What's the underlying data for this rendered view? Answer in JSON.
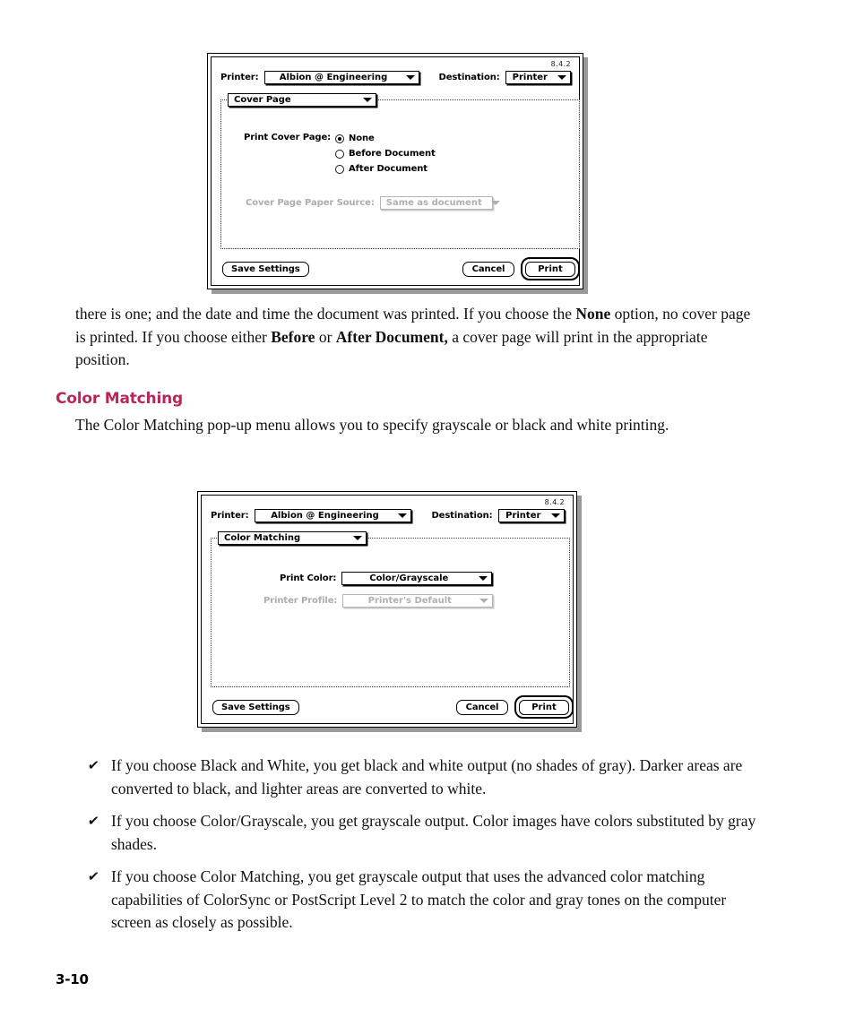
{
  "page": {
    "number": "3-10"
  },
  "dialog_cover_page": {
    "version": "8.4.2",
    "printer_label": "Printer:",
    "printer_value": "Albion @ Engineering",
    "destination_label": "Destination:",
    "destination_value": "Printer",
    "pane_popup_value": "Cover Page",
    "print_cover_page_label": "Print Cover Page:",
    "options": [
      {
        "label": "None",
        "selected": true
      },
      {
        "label": "Before Document",
        "selected": false
      },
      {
        "label": "After Document",
        "selected": false
      }
    ],
    "paper_source_label": "Cover Page Paper Source:",
    "paper_source_value": "Same as document",
    "save_settings_label": "Save Settings",
    "cancel_label": "Cancel",
    "print_label": "Print"
  },
  "dialog_color_matching": {
    "version": "8.4.2",
    "printer_label": "Printer:",
    "printer_value": "Albion @ Engineering",
    "destination_label": "Destination:",
    "destination_value": "Printer",
    "pane_popup_value": "Color Matching",
    "print_color_label": "Print Color:",
    "print_color_value": "Color/Grayscale",
    "printer_profile_label": "Printer Profile:",
    "printer_profile_value": "Printer's Default",
    "save_settings_label": "Save Settings",
    "cancel_label": "Cancel",
    "print_label": "Print"
  },
  "content": {
    "paragraph_intro_html": "there is one; and the date and time the document was printed. If you choose the <b>None</b> option, no cover page is printed. If you choose either <b>Before</b> or <b>After Document,</b> a cover page will print in the appropriate position.",
    "section_heading": "Color Matching",
    "paragraph_color_matching": "The Color Matching pop-up menu allows you to specify grayscale or black and white printing.",
    "bullets": [
      {
        "marker": "✔",
        "text": "If you choose Black and White, you get black and white output (no shades of gray). Darker areas are converted to black, and lighter areas are converted to white."
      },
      {
        "marker": "✔",
        "text": "If you choose Color/Grayscale, you get grayscale output. Color images have colors substituted by gray shades."
      },
      {
        "marker": "✔",
        "text": "If you choose Color Matching, you get grayscale output that uses the advanced color matching capabilities of ColorSync or PostScript Level 2 to match the color and gray tones on the computer screen as closely as possible."
      }
    ]
  },
  "colors": {
    "heading": "#b8275a",
    "dialog_border": "#000000",
    "dialog_shadow": "#9a9a9a",
    "disabled_text": "#b0b0b0"
  }
}
